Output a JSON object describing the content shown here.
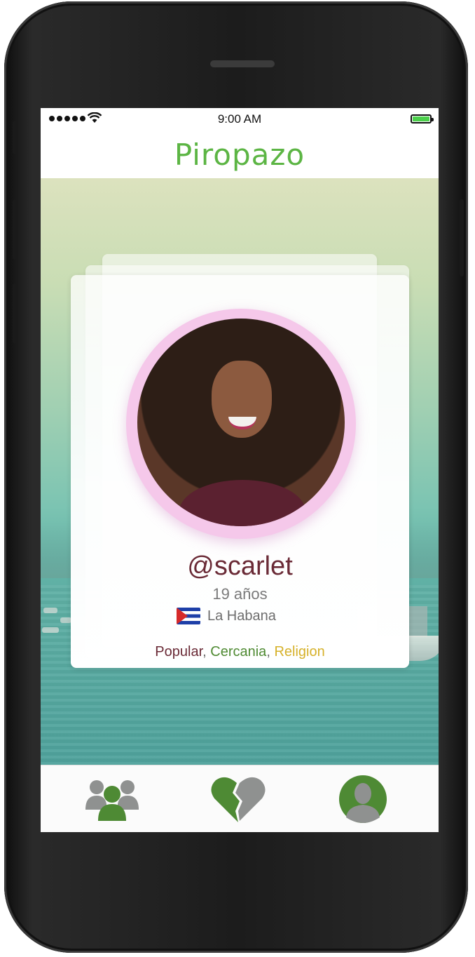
{
  "status_bar": {
    "time": "9:00 AM",
    "signal_bars": 5,
    "battery_level": 1.0
  },
  "header": {
    "title": "Piropazo"
  },
  "profile": {
    "username": "@scarlet",
    "age": "19 años",
    "city": "La Habana",
    "country_flag_icon": "cuba-flag-icon",
    "tags": {
      "popular": "Popular",
      "cercania": "Cercania",
      "religion": "Religion",
      "separator": ", "
    }
  },
  "tab_bar": {
    "items": [
      {
        "icon": "people-icon",
        "active": true
      },
      {
        "icon": "broken-heart-icon",
        "active": false
      },
      {
        "icon": "user-profile-icon",
        "active": false
      }
    ]
  },
  "colors": {
    "brand_green": "#5cb544",
    "tab_green": "#4e8a34",
    "tab_gray": "#8f9190",
    "ring_pink": "#f5c8ea",
    "username_color": "#6a2a36",
    "religion_color": "#d6b12a"
  }
}
